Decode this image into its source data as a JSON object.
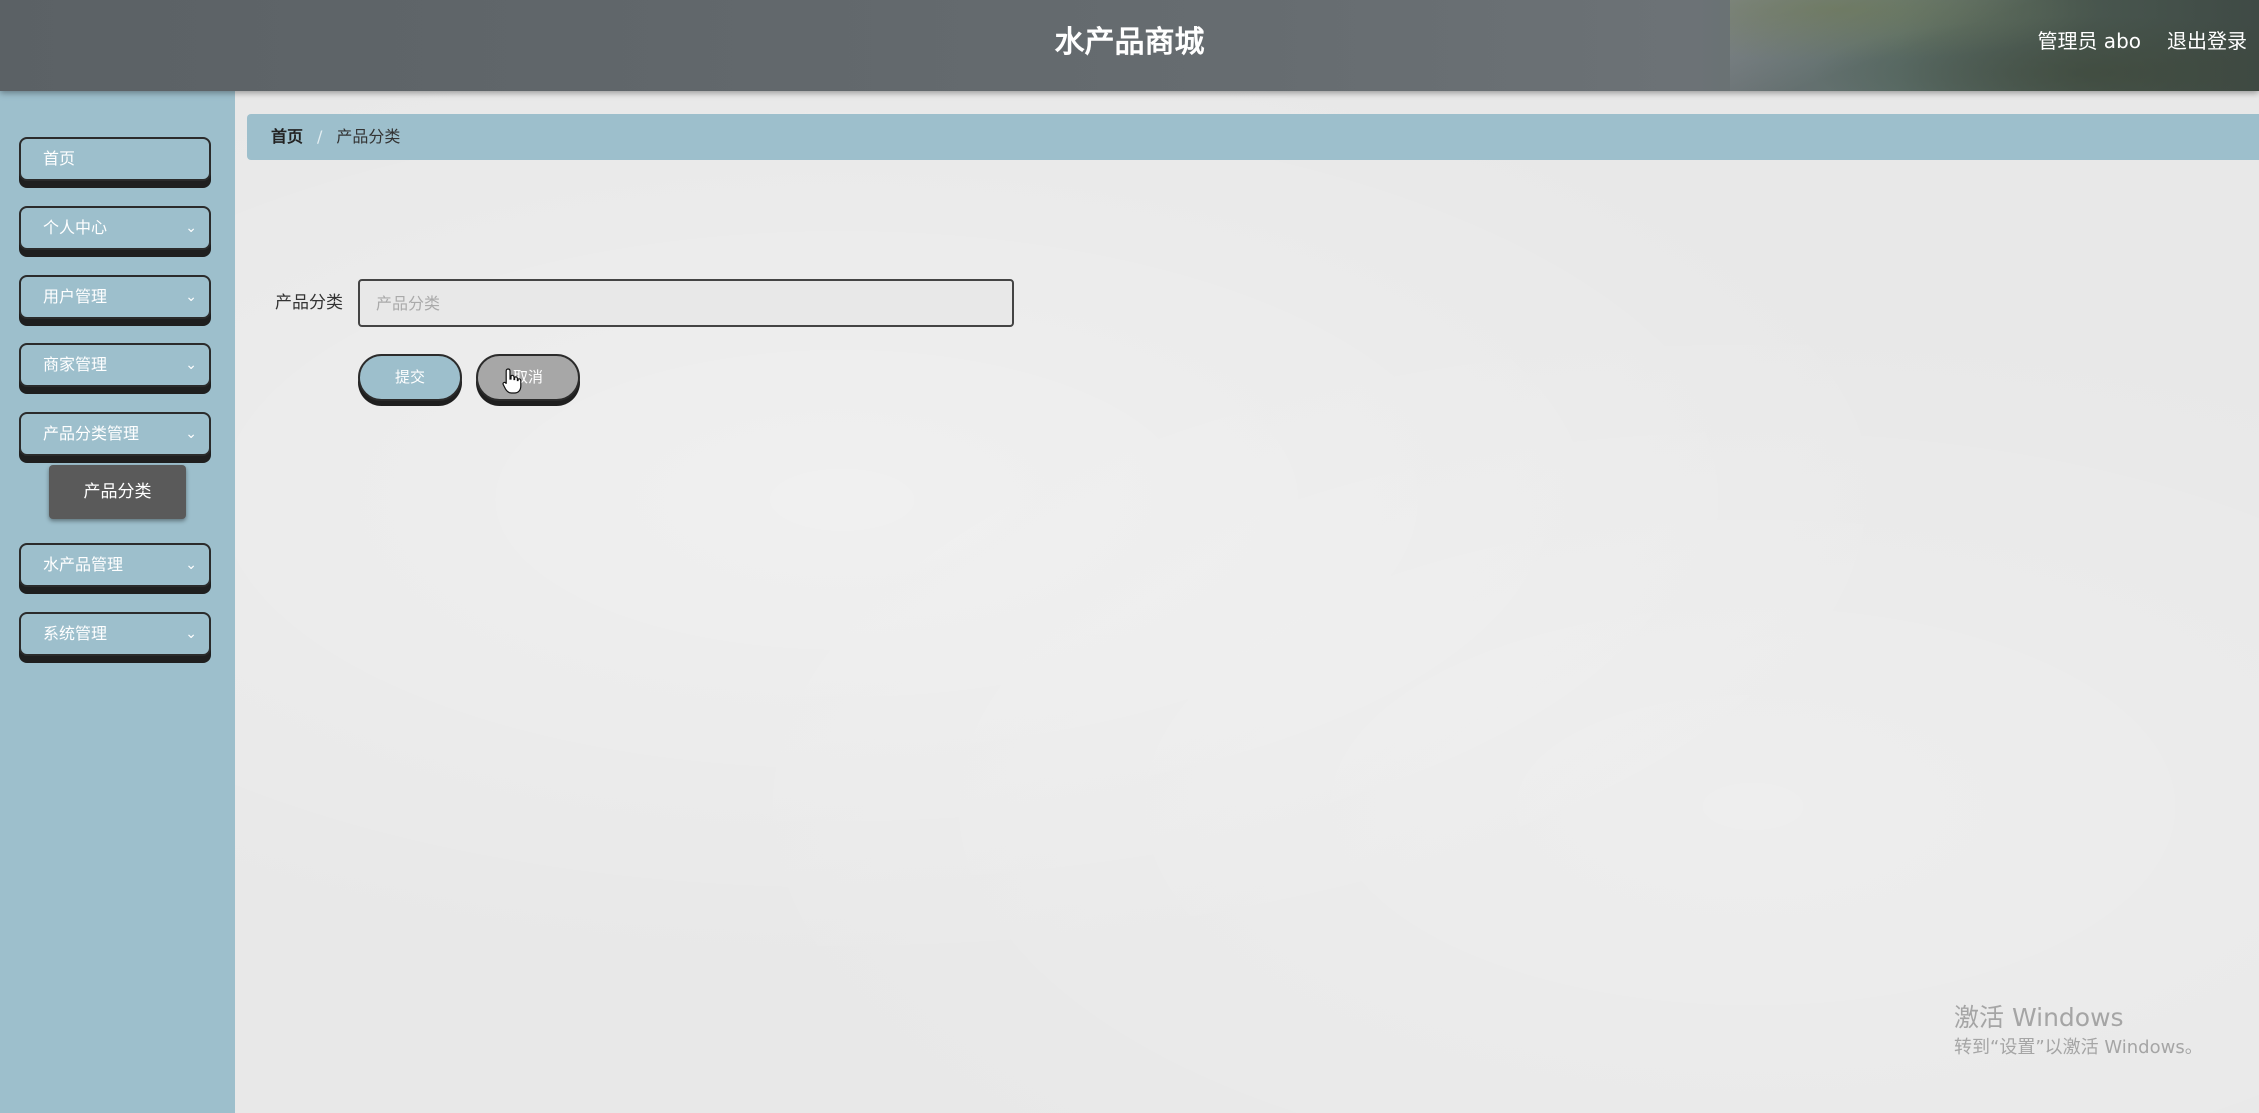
{
  "header": {
    "title": "水产品商城",
    "user": "管理员 abo",
    "logout": "退出登录"
  },
  "sidebar": {
    "items": [
      {
        "label": "首页"
      },
      {
        "label": "个人中心"
      },
      {
        "label": "用户管理"
      },
      {
        "label": "商家管理"
      },
      {
        "label": "产品分类管理"
      },
      {
        "label": "水产品管理"
      },
      {
        "label": "系统管理"
      }
    ],
    "sub_item": "产品分类"
  },
  "breadcrumb": {
    "home": "首页",
    "separator": "/",
    "current": "产品分类"
  },
  "form": {
    "label": "产品分类",
    "placeholder": "产品分类",
    "value": "",
    "submit": "提交",
    "cancel": "取消"
  },
  "watermark": {
    "line1": "激活 Windows",
    "line2": "转到“设置”以激活 Windows。"
  },
  "colors": {
    "accent": "#9dbfcc",
    "header": "#666c70",
    "active_sub": "#5a5a5a"
  }
}
